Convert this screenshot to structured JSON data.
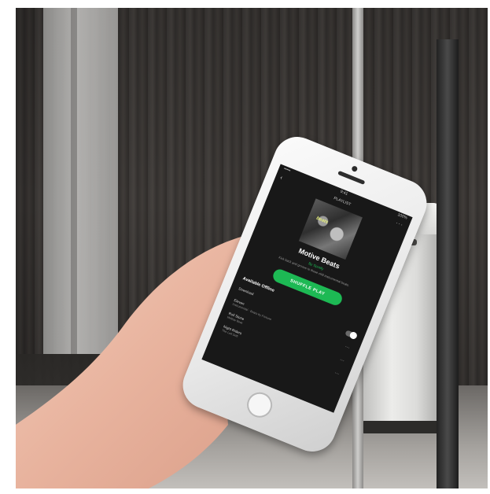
{
  "screen": {
    "status": {
      "carrier": "••••• ",
      "time": "9:41",
      "battery": "100%"
    },
    "nav": {
      "back": "‹",
      "title": "PLAYLIST",
      "more": "···"
    },
    "cover_text": "beats",
    "playlist_title": "Motive Beats",
    "owner": "By Spotify",
    "description": "Kick back and groove to these chill instrumental beats.",
    "shuffle_label": "SHUFFLE PLAY",
    "section_title": "Available Offline",
    "rows": [
      {
        "title": "Download",
        "sub": ""
      },
      {
        "title": "Eleven",
        "sub": "Instrumental · Beats by Fortune"
      },
      {
        "title": "Roll Stone",
        "sub": "Mellow Beat"
      },
      {
        "title": "Night Riders",
        "sub": "The Lofi Drift"
      }
    ]
  },
  "colors": {
    "accent": "#1db954",
    "screen_bg": "#181818"
  }
}
